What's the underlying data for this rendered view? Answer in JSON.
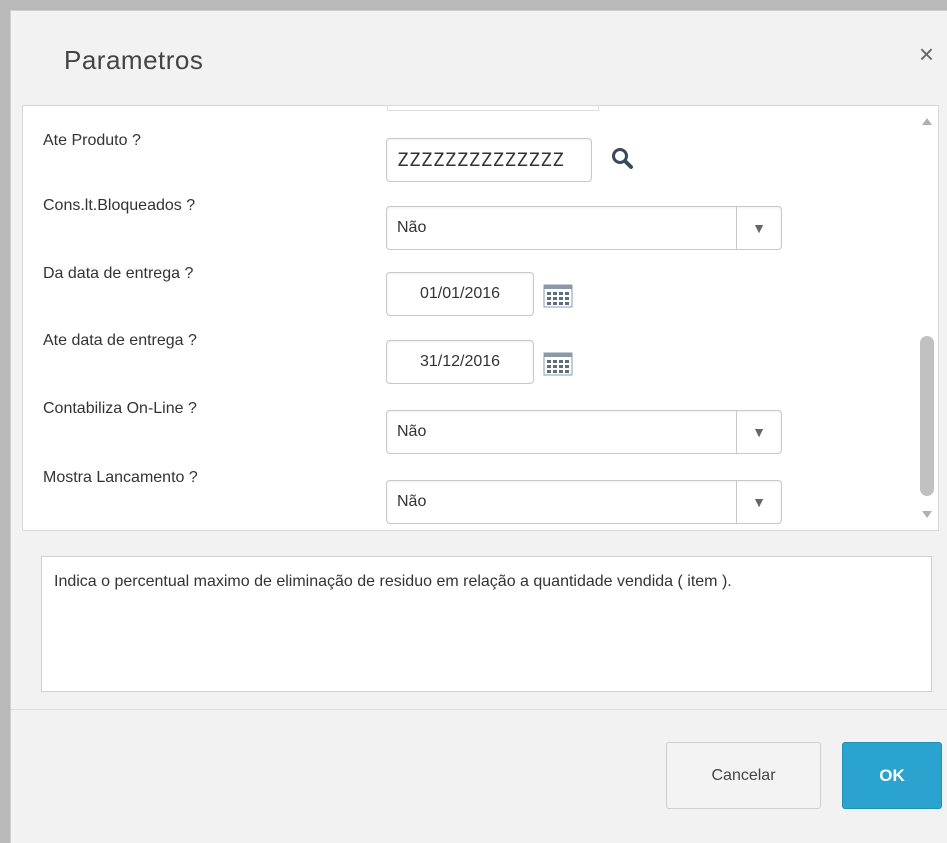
{
  "dialog": {
    "title": "Parametros",
    "close_glyph": "×"
  },
  "params": [
    {
      "label": "Ate Produto ?",
      "type": "text-lookup",
      "value": "ZZZZZZZZZZZZZZ"
    },
    {
      "label": "Cons.lt.Bloqueados ?",
      "type": "select",
      "value": "Não"
    },
    {
      "label": "Da data de entrega ?",
      "type": "date",
      "value": "01/01/2016"
    },
    {
      "label": "Ate data de entrega ?",
      "type": "date",
      "value": "31/12/2016"
    },
    {
      "label": "Contabiliza On-Line ?",
      "type": "select",
      "value": "Não"
    },
    {
      "label": "Mostra Lancamento ?",
      "type": "select",
      "value": "Não"
    }
  ],
  "help_text": "Indica o percentual maximo de eliminação  de residuo em relação a quantidade vendida ( item ).",
  "buttons": {
    "cancel": "Cancelar",
    "ok": "OK"
  },
  "icons": {
    "lookup": "search-icon",
    "date": "calendar-icon",
    "select": "chevron-down-icon",
    "close": "close-icon"
  },
  "colors": {
    "ok_button": "#2aa3cf",
    "background": "#f2f2f2",
    "outside": "#b9b9b9"
  }
}
